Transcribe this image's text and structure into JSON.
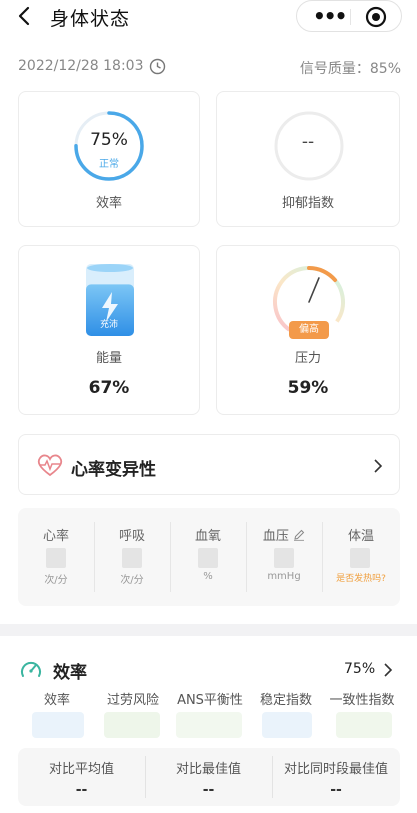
{
  "header": {
    "title": "身体状态",
    "menu_dots": "•••"
  },
  "status": {
    "datetime": "2022/12/28 18:03",
    "signal": "信号质量：85%"
  },
  "cards": {
    "efficiency": {
      "value": "75%",
      "fraction": 0.75,
      "status": "正常",
      "label": "效率",
      "color": "#4aa8e8"
    },
    "depression": {
      "value": "--",
      "label": "抑郁指数"
    },
    "energy": {
      "badge": "充沛",
      "label": "能量",
      "value": "67%",
      "fill": 0.67,
      "color": "#3a9be8"
    },
    "pressure": {
      "badge": "偏高",
      "label": "压力",
      "value": "59%",
      "gauge": 0.59,
      "color": "#f39a4a"
    }
  },
  "hrv": {
    "title": "心率变异性"
  },
  "vitals": [
    {
      "name": "心率",
      "unit": "次/分"
    },
    {
      "name": "呼吸",
      "unit": "次/分"
    },
    {
      "name": "血氧",
      "unit": "%"
    },
    {
      "name": "血压",
      "unit": "mmHg"
    },
    {
      "name": "体温",
      "unit": "是否发热吗?"
    }
  ],
  "efficiency_section": {
    "title": "效率",
    "value": "75%",
    "metrics": [
      "效率",
      "过劳风险",
      "ANS平衡性",
      "稳定指数",
      "一致性指数"
    ],
    "compare": [
      {
        "label": "对比平均值",
        "value": "--"
      },
      {
        "label": "对比最佳值",
        "value": "--"
      },
      {
        "label": "对比同时段最佳值",
        "value": "--"
      }
    ]
  }
}
